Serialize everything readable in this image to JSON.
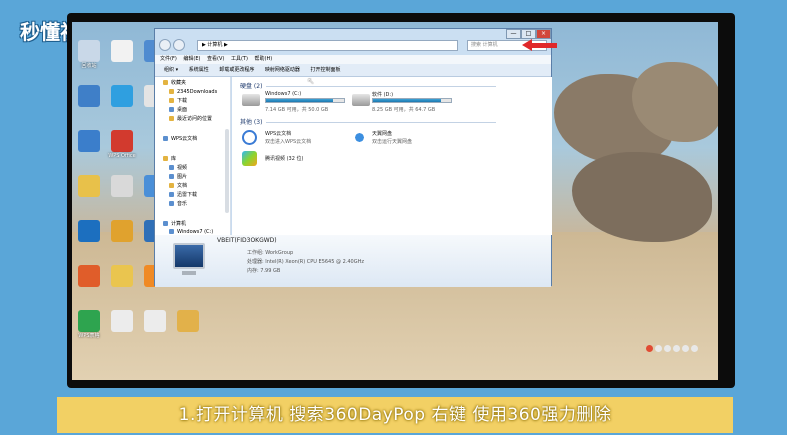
{
  "watermark": {
    "brand": "秒懂视频"
  },
  "caption": "1.打开计算机 搜索360DayPop 右键 使用360强力删除",
  "explorer": {
    "address_path": "▶ 计算机 ▶",
    "search_placeholder": "搜索 计算机",
    "window_controls": [
      "—",
      "□",
      "×"
    ],
    "menu": [
      "文件(F)",
      "编辑(E)",
      "查看(V)",
      "工具(T)",
      "帮助(H)"
    ],
    "toolbar": [
      "组织 ▾",
      "系统属性",
      "卸载或更改程序",
      "映射网络驱动器",
      "打开控制面板"
    ],
    "nav_pane": {
      "favorites_header": "收藏夹",
      "favorites": [
        "2345Downloads",
        "下载",
        "桌面",
        "最近访问的位置"
      ],
      "wps": "WPS云文档",
      "library_header": "库",
      "libraries": [
        "视频",
        "图片",
        "文档",
        "迅雷下载",
        "音乐"
      ],
      "computer_header": "计算机",
      "computer_items": [
        "Windows7 (C:)"
      ]
    },
    "hard_disks": {
      "header": "硬盘 (2)",
      "drives": [
        {
          "name": "Windows7 (C:)",
          "free_text": "7.14 GB 可用，共 50.0 GB",
          "used_fraction": 0.86
        },
        {
          "name": "软件 (D:)",
          "free_text": "8.25 GB 可用，共 64.7 GB",
          "used_fraction": 0.87
        }
      ]
    },
    "other": {
      "header": "其他 (3)",
      "items": [
        {
          "name": "WPS云文档",
          "sub": "双击进入WPS云文档"
        },
        {
          "name": "天翼网盘",
          "sub": "双击运行天翼网盘"
        },
        {
          "name": "腾讯视频 (32 位)",
          "sub": ""
        }
      ]
    },
    "details": {
      "computer_name": "VBEIT(FID3OKGWD)",
      "workgroup": "工作组: WorkGroup",
      "processor": "处理器: Intel(R) Xeon(R) CPU          E5645 @ 2.40GHz",
      "memory": "内存: 7.99 GB"
    }
  },
  "desktop_icons": [
    {
      "label": "回收站",
      "color": "#c9d8e8"
    },
    {
      "label": "",
      "color": "#f2f2f2"
    },
    {
      "label": "",
      "color": "#4f8bd0"
    },
    {
      "label": "",
      "color": "#3f7fc8"
    },
    {
      "label": "",
      "color": "#2f9fe0"
    },
    {
      "label": "",
      "color": "#e4e4e4"
    },
    {
      "label": "",
      "color": "#3b7ecb"
    },
    {
      "label": "WPS Office",
      "color": "#d23a2e"
    },
    {
      "label": "",
      "color": "#e8c14a"
    },
    {
      "label": "",
      "color": "#d9d9d9"
    },
    {
      "label": "",
      "color": "#4a8fd8"
    },
    {
      "label": "",
      "color": "#1c6fbf"
    },
    {
      "label": "",
      "color": "#e0a22e"
    },
    {
      "label": "",
      "color": "#2f6fb7"
    },
    {
      "label": "",
      "color": "#e05d2a"
    },
    {
      "label": "",
      "color": "#eac54f"
    },
    {
      "label": "",
      "color": "#f08a24"
    },
    {
      "label": "",
      "color": "#3da34a"
    },
    {
      "label": "WPS表格",
      "color": "#2ea44f"
    },
    {
      "label": "",
      "color": "#ececec"
    },
    {
      "label": "",
      "color": "#ececec"
    },
    {
      "label": "",
      "color": "#e2b14a"
    }
  ],
  "colors": {
    "accent_red": "#e0282a",
    "caption_bg": "#f2d064",
    "drive_fill": "#1d78b0"
  }
}
